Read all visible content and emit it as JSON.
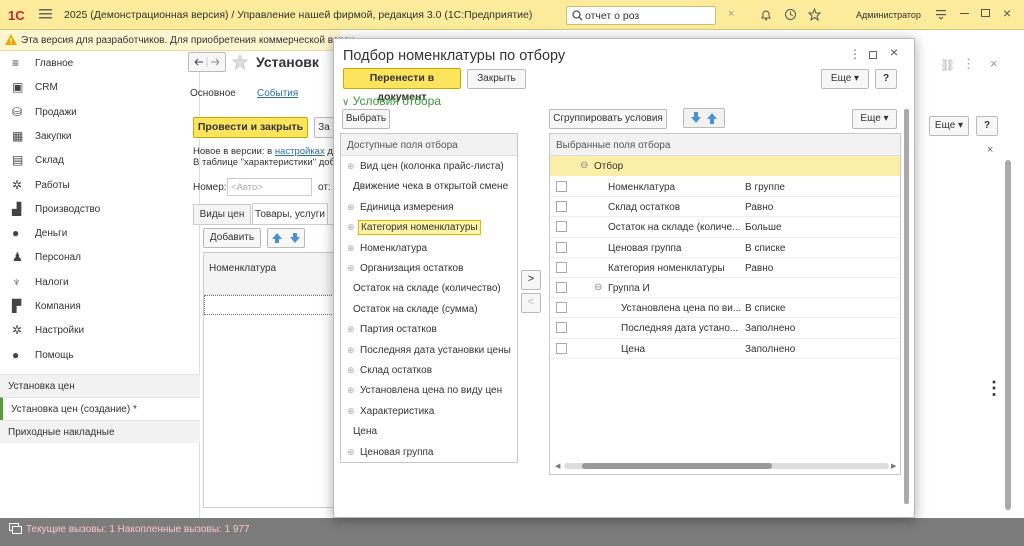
{
  "titlebar": {
    "logo": "1С",
    "title": "2025 (Демонстрационная версия) / Управление нашей фирмой, редакция 3.0  (1С:Предприятие)",
    "search_value": "отчет о роз",
    "user": "Администратор"
  },
  "warning": {
    "text": "Эта версия для разработчиков. Для приобретения коммерческой верси"
  },
  "sidebar": {
    "items": [
      {
        "label": "Главное",
        "icon": "menu-lines-icon"
      },
      {
        "label": "CRM",
        "icon": "crm-icon"
      },
      {
        "label": "Продажи",
        "icon": "sales-icon"
      },
      {
        "label": "Закупки",
        "icon": "purchases-icon"
      },
      {
        "label": "Склад",
        "icon": "warehouse-icon"
      },
      {
        "label": "Работы",
        "icon": "works-icon"
      },
      {
        "label": "Производство",
        "icon": "factory-icon"
      },
      {
        "label": "Деньги",
        "icon": "money-icon"
      },
      {
        "label": "Персонал",
        "icon": "staff-icon"
      },
      {
        "label": "Налоги",
        "icon": "taxes-icon"
      },
      {
        "label": "Компания",
        "icon": "company-icon"
      },
      {
        "label": "Настройки",
        "icon": "gear-icon"
      },
      {
        "label": "Помощь",
        "icon": "help-icon"
      }
    ],
    "open_tabs": [
      "Установка цен",
      "Установка цен (создание) *",
      "Приходные накладные"
    ]
  },
  "bgform": {
    "title": "Установк",
    "tab_main": "Основное",
    "tab_events": "События",
    "post_close": "Провести и закрыть",
    "post_close_tail": "За",
    "news_prefix": "Новое в версии: в ",
    "news_link": "настройках",
    "news_tail": " д",
    "news_line2": "В таблице \"характеристики\" доб",
    "number_label": "Номер:",
    "number_placeholder": "<Авто>",
    "from_label": "от:",
    "subtab1": "Виды цен",
    "subtab2": "Товары, услуги",
    "add": "Добавить",
    "col_nomenclature": "Номенклатура",
    "more": "Еще",
    "help": "?"
  },
  "status": {
    "text": "Текущие вызовы: 1   Накопленные вызовы: 1 977"
  },
  "modal": {
    "title": "Подбор номенклатуры по отбору",
    "transfer_btn": "Перенести в документ",
    "close_btn": "Закрыть",
    "more": "Еще",
    "help": "?",
    "section_title": "Условия отбора",
    "choose_btn": "Выбрать",
    "group_btn": "Сгруппировать условия",
    "more2": "Еще",
    "left_header": "Доступные поля отбора",
    "right_header": "Выбранные поля отбора",
    "available_fields": [
      {
        "label": "Вид цен  (колонка прайс-листа)",
        "expandable": true
      },
      {
        "label": "Движение чека в открытой смене",
        "expandable": false
      },
      {
        "label": "Единица измерения",
        "expandable": true
      },
      {
        "label": "Категория номенклатуры",
        "expandable": true,
        "selected": true
      },
      {
        "label": "Номенклатура",
        "expandable": true
      },
      {
        "label": "Организация остатков",
        "expandable": true
      },
      {
        "label": "Остаток на складе (количество)",
        "expandable": false
      },
      {
        "label": "Остаток на складе (сумма)",
        "expandable": false
      },
      {
        "label": "Партия остатков",
        "expandable": true
      },
      {
        "label": "Последняя дата установки цены",
        "expandable": true
      },
      {
        "label": "Склад остатков",
        "expandable": true
      },
      {
        "label": "Установлена цена по виду цен",
        "expandable": true
      },
      {
        "label": "Характеристика",
        "expandable": true
      },
      {
        "label": "Цена",
        "expandable": false
      },
      {
        "label": "Ценовая группа",
        "expandable": true
      }
    ],
    "selected_root": "Отбор",
    "selected_fields": [
      {
        "field": "Номенклатура",
        "condition": "В группе",
        "level": 1
      },
      {
        "field": "Склад остатков",
        "condition": "Равно",
        "level": 1
      },
      {
        "field": "Остаток на складе (количе...",
        "condition": "Больше",
        "level": 1
      },
      {
        "field": "Ценовая группа",
        "condition": "В списке",
        "level": 1
      },
      {
        "field": "Категория номенклатуры",
        "condition": "Равно",
        "level": 1
      },
      {
        "field": "Группа И",
        "condition": "",
        "level": 1,
        "group": true
      },
      {
        "field": "Установлена цена по ви...",
        "condition": "В списке",
        "level": 2
      },
      {
        "field": "Последняя дата устано...",
        "condition": "Заполнено",
        "level": 2
      },
      {
        "field": "Цена",
        "condition": "Заполнено",
        "level": 2
      }
    ]
  }
}
